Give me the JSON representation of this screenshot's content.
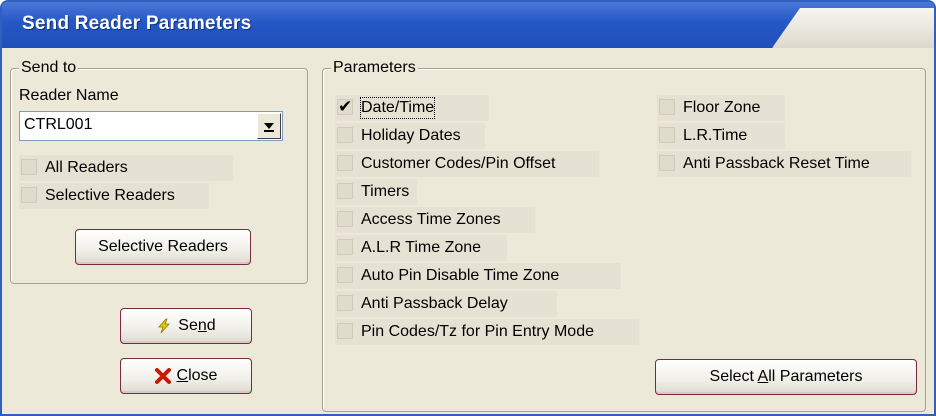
{
  "window": {
    "title": "Send Reader Parameters"
  },
  "send_to": {
    "legend": "Send to",
    "reader_name_label": "Reader Name",
    "reader_name_value": "CTRL001",
    "all_readers": {
      "label": "All Readers",
      "checked": false
    },
    "selective_readers_checkbox": {
      "label": "Selective Readers",
      "checked": false
    },
    "selective_readers_button": "Selective Readers"
  },
  "actions": {
    "send_pre": "Se",
    "send_underline": "n",
    "send_post": "d",
    "close_underline": "C",
    "close_post": "lose"
  },
  "parameters": {
    "legend": "Parameters",
    "left_column": [
      {
        "label": "Date/Time",
        "checked": true,
        "check_glyph": "✔"
      },
      {
        "label": "Holiday Dates",
        "checked": false
      },
      {
        "label": "Customer Codes/Pin Offset",
        "checked": false
      },
      {
        "label": "Timers",
        "checked": false
      },
      {
        "label": "Access Time Zones",
        "checked": false
      },
      {
        "label": "A.L.R Time Zone",
        "checked": false
      },
      {
        "label": "Auto Pin Disable Time Zone",
        "checked": false
      },
      {
        "label": "Anti Passback Delay",
        "checked": false
      },
      {
        "label": "Pin Codes/Tz for Pin Entry Mode",
        "checked": false
      }
    ],
    "right_column": [
      {
        "label": "Floor Zone",
        "checked": false
      },
      {
        "label": "L.R.Time",
        "checked": false
      },
      {
        "label": "Anti Passback Reset Time",
        "checked": false
      }
    ],
    "select_all_pre": "Select ",
    "select_all_underline": "A",
    "select_all_post": "ll Parameters"
  },
  "colors": {
    "titlebar": "#2457c5",
    "face": "#ece9d8",
    "button_border": "#7a2a3c",
    "send_icon": "#d8c000",
    "close_icon": "#c81a00"
  },
  "icons": {
    "send": "lightning-bolt-icon",
    "close": "red-x-icon",
    "dropdown": "chevron-down-icon"
  }
}
